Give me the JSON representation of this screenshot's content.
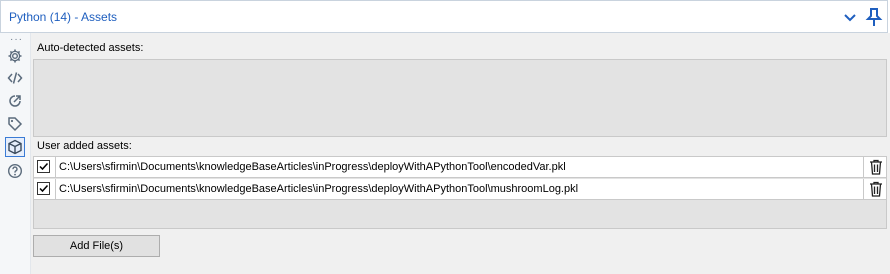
{
  "header": {
    "title": "Python (14) - Assets"
  },
  "sidebar": {
    "items": [
      {
        "icon": "gear-icon"
      },
      {
        "icon": "code-icon"
      },
      {
        "icon": "export-icon"
      },
      {
        "icon": "tag-icon"
      },
      {
        "icon": "package-icon",
        "active": true
      },
      {
        "icon": "help-icon"
      }
    ]
  },
  "auto_assets": {
    "label": "Auto-detected assets:"
  },
  "user_assets": {
    "label": "User added assets:",
    "rows": [
      {
        "checked": true,
        "path": "C:\\Users\\sfirmin\\Documents\\knowledgeBaseArticles\\inProgress\\deployWithAPythonTool\\encodedVar.pkl"
      },
      {
        "checked": true,
        "path": "C:\\Users\\sfirmin\\Documents\\knowledgeBaseArticles\\inProgress\\deployWithAPythonTool\\mushroomLog.pkl"
      }
    ]
  },
  "actions": {
    "add_files_label": "Add File(s)"
  },
  "colors": {
    "accent": "#1f5fbf",
    "panel": "#f0f0f0",
    "list_bg": "#e3e3e3"
  }
}
